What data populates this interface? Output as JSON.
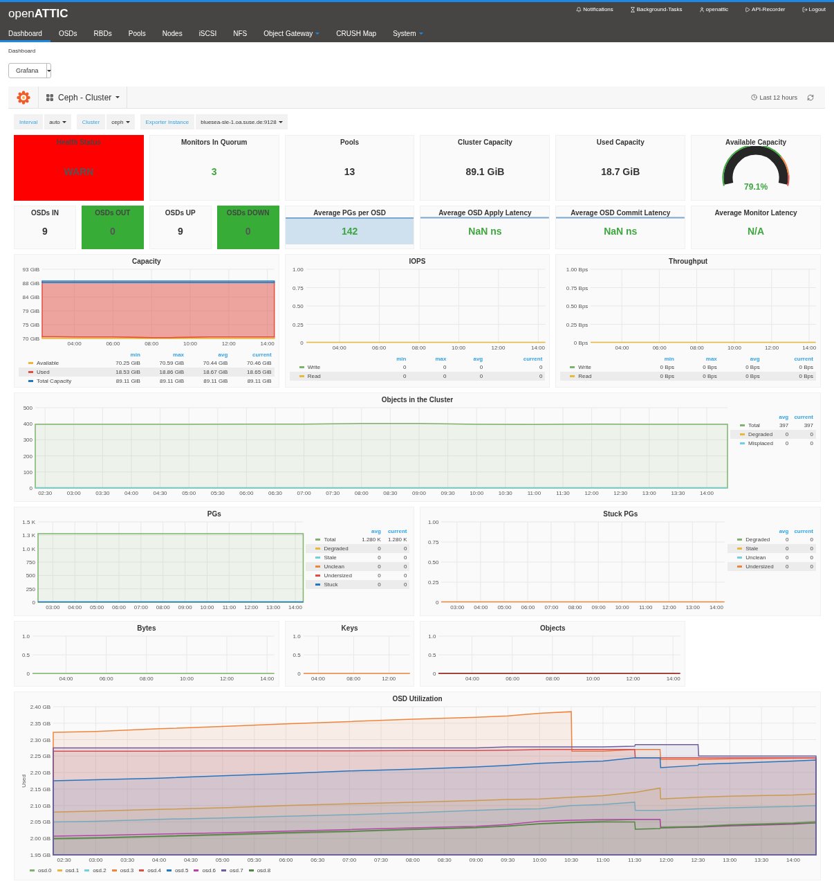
{
  "brand": "open**ATTIC**",
  "top_links": [
    "Notifications",
    "Background-Tasks",
    "openattic",
    "API-Recorder",
    "Logout"
  ],
  "nav": [
    {
      "label": "Dashboard",
      "selected": true,
      "dropdown": false
    },
    {
      "label": "OSDs",
      "selected": false,
      "dropdown": false
    },
    {
      "label": "RBDs",
      "selected": false,
      "dropdown": false
    },
    {
      "label": "Pools",
      "selected": false,
      "dropdown": false
    },
    {
      "label": "Nodes",
      "selected": false,
      "dropdown": false
    },
    {
      "label": "iSCSI",
      "selected": false,
      "dropdown": false
    },
    {
      "label": "NFS",
      "selected": false,
      "dropdown": false
    },
    {
      "label": "Object Gateway",
      "selected": false,
      "dropdown": true
    },
    {
      "label": "CRUSH Map",
      "selected": false,
      "dropdown": false
    },
    {
      "label": "System",
      "selected": false,
      "dropdown": true
    }
  ],
  "breadcrumb": "Dashboard",
  "view_select": {
    "value": "Grafana"
  },
  "dashboard": {
    "title": "Ceph - Cluster",
    "time_range": "Last 12 hours"
  },
  "variables": [
    {
      "label": "Interval",
      "value": "auto"
    },
    {
      "label": "Cluster",
      "value": "ceph"
    },
    {
      "label": "Exporter Instance",
      "value": "bluesea-sle-1.oa.suse.de:9128"
    }
  ],
  "stats": [
    {
      "title": "Health Status",
      "value": "WARN",
      "kind": "stat",
      "color": "#ff0000",
      "highlighted": false
    },
    {
      "title": "Monitors In Quorum",
      "value": "3",
      "kind": "stat",
      "highlighted": true
    },
    {
      "title": "Pools",
      "value": "13",
      "kind": "stat",
      "highlighted": false
    },
    {
      "title": "Cluster Capacity",
      "value": "89.1 GiB",
      "kind": "stat",
      "highlighted": false
    },
    {
      "title": "Used Capacity",
      "value": "18.7 GiB",
      "kind": "stat",
      "highlighted": false
    },
    {
      "title": "Available Capacity",
      "value": "79.1%",
      "kind": "gauge",
      "highlighted": true
    },
    {
      "title": "OSDs IN",
      "value": "9",
      "kind": "stat",
      "highlighted": false
    },
    {
      "title": "OSDs OUT",
      "value": "0",
      "kind": "stat",
      "color": "#37ad37",
      "highlighted": false
    },
    {
      "title": "OSDs UP",
      "value": "9",
      "kind": "stat",
      "highlighted": false
    },
    {
      "title": "OSDs DOWN",
      "value": "0",
      "kind": "stat",
      "color": "#37ad37",
      "highlighted": false
    },
    {
      "title": "Average PGs per OSD",
      "value": "142",
      "kind": "sparkline-fill",
      "highlighted": true
    },
    {
      "title": "Average OSD Apply Latency",
      "value": "NaN ns",
      "kind": "sparkline",
      "highlighted": true
    },
    {
      "title": "Average OSD Commit Latency",
      "value": "NaN ns",
      "kind": "sparkline",
      "highlighted": true
    },
    {
      "title": "Average Monitor Latency",
      "value": "N/A",
      "kind": "stat",
      "highlighted": true
    }
  ],
  "graphs": [
    {
      "title": "Capacity",
      "chart_data": {
        "type": "line",
        "grid": true,
        "x": [
          2.33,
          3,
          4,
          5,
          6,
          7,
          8,
          9,
          10,
          11,
          12,
          13,
          14.36
        ],
        "xlim": [
          2.33,
          14.36
        ],
        "ylim": [
          70,
          93
        ],
        "xticks": [
          {
            "value": 4,
            "label": "04:00"
          },
          {
            "value": 6,
            "label": "06:00"
          },
          {
            "value": 8,
            "label": "08:00"
          },
          {
            "value": 10,
            "label": "10:00"
          },
          {
            "value": 12,
            "label": "12:00"
          },
          {
            "value": 14,
            "label": "14:00"
          }
        ],
        "yticks": [
          {
            "value": 70,
            "label": "70 GiB"
          },
          {
            "value": 74.6,
            "label": "75 GiB"
          },
          {
            "value": 79.2,
            "label": "79 GiB"
          },
          {
            "value": 83.8,
            "label": "84 GiB"
          },
          {
            "value": 88.4,
            "label": "88 GiB"
          },
          {
            "value": 93,
            "label": "93 GiB"
          }
        ],
        "series": [
          {
            "name": "Available",
            "type": "area",
            "color": "#eab839",
            "values": [
              70.6,
              70.6,
              70.5,
              70.5,
              70.5,
              70.4,
              70.3,
              70.3,
              70.4,
              70.5,
              70.5,
              70.5,
              70.5
            ]
          },
          {
            "name": "Used",
            "type": "area",
            "color": "#e24d42",
            "values": [
              88.6,
              88.6,
              88.6,
              88.6,
              88.6,
              88.6,
              88.6,
              88.6,
              88.6,
              88.6,
              88.6,
              88.6,
              88.6
            ]
          },
          {
            "name": "Total Capacity",
            "type": "area",
            "color": "#1f78c1",
            "values": [
              89.1,
              89.1,
              89.1,
              89.1,
              89.1,
              89.1,
              89.1,
              89.1,
              89.1,
              89.1,
              89.1,
              89.1,
              89.1
            ]
          }
        ]
      },
      "legend": {
        "kind": "table-below",
        "columns": [
          "min",
          "max",
          "avg",
          "current"
        ],
        "rows": [
          {
            "cells": [
              "70.25 GiB",
              "70.59 GiB",
              "70.44 GiB",
              "70.46 GiB"
            ]
          },
          {
            "cells": [
              "18.53 GiB",
              "18.86 GiB",
              "18.67 GiB",
              "18.65 GiB"
            ]
          },
          {
            "cells": [
              "89.11 GiB",
              "89.11 GiB",
              "89.11 GiB",
              "89.11 GiB"
            ]
          }
        ]
      }
    },
    {
      "title": "IOPS",
      "chart_data": {
        "type": "line",
        "grid": true,
        "x": [
          2.33,
          14.36
        ],
        "xlim": [
          2.33,
          14.36
        ],
        "ylim": [
          0,
          1
        ],
        "xticks": [
          {
            "value": 4,
            "label": "04:00"
          },
          {
            "value": 6,
            "label": "06:00"
          },
          {
            "value": 8,
            "label": "08:00"
          },
          {
            "value": 10,
            "label": "10:00"
          },
          {
            "value": 12,
            "label": "12:00"
          },
          {
            "value": 14,
            "label": "14:00"
          }
        ],
        "yticks": [
          0,
          {
            "value": 0.25,
            "label": "0.25"
          },
          {
            "value": 0.5,
            "label": "0.50"
          },
          {
            "value": 0.75,
            "label": "0.75"
          },
          {
            "value": 1,
            "label": "1.00"
          }
        ],
        "series": [
          {
            "name": "Write",
            "color": "#7eb26d",
            "values": [
              null,
              null
            ]
          },
          {
            "name": "Read",
            "color": "#eab839",
            "values": [
              0,
              0
            ]
          }
        ]
      },
      "legend": {
        "kind": "table-below",
        "columns": [
          "min",
          "max",
          "avg",
          "current"
        ],
        "rows": [
          {
            "cells": [
              "0",
              "0",
              "0",
              "0"
            ]
          },
          {
            "cells": [
              "0",
              "0",
              "0",
              "0"
            ]
          }
        ]
      }
    },
    {
      "title": "Throughput",
      "chart_data": {
        "type": "line",
        "grid": true,
        "x": [
          2.33,
          14.36
        ],
        "xlim": [
          2.33,
          14.36
        ],
        "ylim": [
          0,
          1
        ],
        "xticks": [
          {
            "value": 4,
            "label": "04:00"
          },
          {
            "value": 6,
            "label": "06:00"
          },
          {
            "value": 8,
            "label": "08:00"
          },
          {
            "value": 10,
            "label": "10:00"
          },
          {
            "value": 12,
            "label": "12:00"
          },
          {
            "value": 14,
            "label": "14:00"
          }
        ],
        "yticks": [
          {
            "value": 0,
            "label": "0 Bps"
          },
          {
            "value": 0.25,
            "label": "0.25 Bps"
          },
          {
            "value": 0.5,
            "label": "0.50 Bps"
          },
          {
            "value": 0.75,
            "label": "0.75 Bps"
          },
          {
            "value": 1,
            "label": "1.00 Bps"
          }
        ],
        "series": [
          {
            "name": "Write",
            "color": "#7eb26d",
            "values": [
              null,
              null
            ]
          },
          {
            "name": "Read",
            "color": "#eab839",
            "values": [
              0,
              0
            ]
          }
        ]
      },
      "legend": {
        "kind": "table-below",
        "columns": [
          "min",
          "max",
          "avg",
          "current"
        ],
        "rows": [
          {
            "cells": [
              "0 Bps",
              "0 Bps",
              "0 Bps",
              "0 Bps"
            ]
          },
          {
            "cells": [
              "0 Bps",
              "0 Bps",
              "0 Bps",
              "0 Bps"
            ]
          }
        ]
      }
    },
    {
      "title": "Objects in the Cluster",
      "chart_data": {
        "type": "line",
        "grid": true,
        "x": [
          2.33,
          3,
          4,
          5,
          6,
          7,
          8,
          9,
          10,
          11,
          12,
          13,
          14.36
        ],
        "xlim": [
          2.33,
          14.36
        ],
        "ylim": [
          0,
          500
        ],
        "xticks": [
          {
            "value": 2.5,
            "label": "02:30"
          },
          {
            "value": 3,
            "label": "03:00"
          },
          {
            "value": 3.5,
            "label": "03:30"
          },
          {
            "value": 4,
            "label": "04:00"
          },
          {
            "value": 4.5,
            "label": "04:30"
          },
          {
            "value": 5,
            "label": "05:00"
          },
          {
            "value": 5.5,
            "label": "05:30"
          },
          {
            "value": 6,
            "label": "06:00"
          },
          {
            "value": 6.5,
            "label": "06:30"
          },
          {
            "value": 7,
            "label": "07:00"
          },
          {
            "value": 7.5,
            "label": "07:30"
          },
          {
            "value": 8,
            "label": "08:00"
          },
          {
            "value": 8.5,
            "label": "08:30"
          },
          {
            "value": 9,
            "label": "09:00"
          },
          {
            "value": 9.5,
            "label": "09:30"
          },
          {
            "value": 10,
            "label": "10:00"
          },
          {
            "value": 10.5,
            "label": "10:30"
          },
          {
            "value": 11,
            "label": "11:00"
          },
          {
            "value": 11.5,
            "label": "11:30"
          },
          {
            "value": 12,
            "label": "12:00"
          },
          {
            "value": 12.5,
            "label": "12:30"
          },
          {
            "value": 13,
            "label": "13:00"
          },
          {
            "value": 13.5,
            "label": "13:30"
          },
          {
            "value": 14,
            "label": "14:00"
          }
        ],
        "yticks": [
          0,
          100,
          200,
          300,
          400,
          500
        ],
        "series": [
          {
            "name": "Total",
            "type": "area",
            "color": "#7eb26d",
            "values": [
              397,
              397,
              397,
              397,
              398,
              398,
              402,
              402,
              397,
              395,
              398,
              397,
              397
            ]
          },
          {
            "name": "Degraded",
            "color": "#eab839",
            "values": [
              null,
              null,
              null,
              null,
              null,
              null,
              null,
              null,
              null,
              null,
              null,
              null,
              null
            ]
          },
          {
            "name": "Misplaced",
            "color": "#6ed0e0",
            "values": [
              0,
              0,
              0,
              0,
              0,
              0,
              0,
              0,
              0,
              0,
              0,
              0,
              0
            ]
          }
        ]
      },
      "legend": {
        "kind": "table-right",
        "columns": [
          "avg",
          "current"
        ],
        "rows": [
          {
            "cells": [
              "397",
              "397"
            ]
          },
          {
            "cells": [
              "0",
              "0"
            ]
          },
          {
            "cells": [
              "0",
              "0"
            ]
          }
        ]
      }
    },
    {
      "title": "PGs",
      "chart_data": {
        "type": "line",
        "grid": true,
        "x": [
          2.33,
          14.36
        ],
        "xlim": [
          2.33,
          14.36
        ],
        "ylim": [
          0,
          1500
        ],
        "xticks": [
          {
            "value": 3,
            "label": "03:00"
          },
          {
            "value": 4,
            "label": "04:00"
          },
          {
            "value": 5,
            "label": "05:00"
          },
          {
            "value": 6,
            "label": "06:00"
          },
          {
            "value": 7,
            "label": "07:00"
          },
          {
            "value": 8,
            "label": "08:00"
          },
          {
            "value": 9,
            "label": "09:00"
          },
          {
            "value": 10,
            "label": "10:00"
          },
          {
            "value": 11,
            "label": "11:00"
          },
          {
            "value": 12,
            "label": "12:00"
          },
          {
            "value": 13,
            "label": "13:00"
          },
          {
            "value": 14,
            "label": "14:00"
          }
        ],
        "yticks": [
          0,
          250,
          500,
          750,
          {
            "value": 1000,
            "label": "1.0 K"
          },
          {
            "value": 1250,
            "label": "1.3 K"
          },
          {
            "value": 1500,
            "label": "1.5 K"
          }
        ],
        "series": [
          {
            "name": "Total",
            "type": "area",
            "color": "#7eb26d",
            "values": [
              1280,
              1280
            ]
          },
          {
            "name": "Degraded",
            "color": "#eab839",
            "values": [
              null,
              null
            ]
          },
          {
            "name": "Stale",
            "color": "#6ed0e0",
            "values": [
              null,
              null
            ]
          },
          {
            "name": "Unclean",
            "color": "#ef843c",
            "values": [
              null,
              null
            ]
          },
          {
            "name": "Undersized",
            "color": "#e24d42",
            "values": [
              null,
              null
            ]
          },
          {
            "name": "Stuck",
            "color": "#1f78c1",
            "values": [
              0,
              0
            ]
          }
        ]
      },
      "legend": {
        "kind": "table-right",
        "columns": [
          "avg",
          "current"
        ],
        "rows": [
          {
            "cells": [
              "1.280 K",
              "1.280 K"
            ]
          },
          {
            "cells": [
              "0",
              "0"
            ]
          },
          {
            "cells": [
              "0",
              "0"
            ]
          },
          {
            "cells": [
              "0",
              "0"
            ]
          },
          {
            "cells": [
              "0",
              "0"
            ]
          },
          {
            "cells": [
              "0",
              "0"
            ]
          }
        ]
      }
    },
    {
      "title": "Stuck PGs",
      "chart_data": {
        "type": "line",
        "grid": true,
        "x": [
          2.33,
          14.36
        ],
        "xlim": [
          2.33,
          14.36
        ],
        "ylim": [
          0,
          1
        ],
        "xticks": [
          {
            "value": 3,
            "label": "03:00"
          },
          {
            "value": 4,
            "label": "04:00"
          },
          {
            "value": 5,
            "label": "05:00"
          },
          {
            "value": 6,
            "label": "06:00"
          },
          {
            "value": 7,
            "label": "07:00"
          },
          {
            "value": 8,
            "label": "08:00"
          },
          {
            "value": 9,
            "label": "09:00"
          },
          {
            "value": 10,
            "label": "10:00"
          },
          {
            "value": 11,
            "label": "11:00"
          },
          {
            "value": 12,
            "label": "12:00"
          },
          {
            "value": 13,
            "label": "13:00"
          },
          {
            "value": 14,
            "label": "14:00"
          }
        ],
        "yticks": [
          0,
          {
            "value": 0.25,
            "label": "0.25"
          },
          {
            "value": 0.5,
            "label": "0.50"
          },
          {
            "value": 0.75,
            "label": "0.75"
          },
          {
            "value": 1,
            "label": "1.00"
          }
        ],
        "series": [
          {
            "name": "Degraded",
            "color": "#7eb26d",
            "values": [
              null,
              null
            ]
          },
          {
            "name": "Stale",
            "color": "#eab839",
            "values": [
              null,
              null
            ]
          },
          {
            "name": "Unclean",
            "color": "#6ed0e0",
            "values": [
              null,
              null
            ]
          },
          {
            "name": "Undersized",
            "color": "#ef843c",
            "values": [
              0,
              0
            ]
          }
        ]
      },
      "legend": {
        "kind": "table-right",
        "columns": [
          "avg",
          "current"
        ],
        "rows": [
          {
            "cells": [
              "0",
              "0"
            ]
          },
          {
            "cells": [
              "0",
              "0"
            ]
          },
          {
            "cells": [
              "0",
              "0"
            ]
          },
          {
            "cells": [
              "0",
              "0"
            ]
          }
        ]
      }
    },
    {
      "title": "Bytes",
      "chart_data": {
        "type": "line",
        "grid": true,
        "x": [
          2.33,
          14.36
        ],
        "xlim": [
          2.33,
          14.36
        ],
        "ylim": [
          0,
          1
        ],
        "xticks": [
          {
            "value": 4,
            "label": "04:00"
          },
          {
            "value": 6,
            "label": "06:00"
          },
          {
            "value": 8,
            "label": "08:00"
          },
          {
            "value": 10,
            "label": "10:00"
          },
          {
            "value": 12,
            "label": "12:00"
          },
          {
            "value": 14,
            "label": "14:00"
          }
        ],
        "yticks": [
          0,
          {
            "value": 0.5,
            "label": "0.5"
          },
          {
            "value": 1,
            "label": "1.0"
          }
        ],
        "series": [
          {
            "color": "#7eb26d",
            "values": [
              0,
              0
            ]
          }
        ]
      }
    },
    {
      "title": "Keys",
      "chart_data": {
        "type": "line",
        "grid": true,
        "x": [
          2.33,
          14.36
        ],
        "xlim": [
          2.33,
          14.36
        ],
        "ylim": [
          0,
          1
        ],
        "xticks": [
          {
            "value": 4,
            "label": "04:00"
          },
          {
            "value": 8,
            "label": "08:00"
          },
          {
            "value": 12,
            "label": "12:00"
          }
        ],
        "yticks": [
          0,
          {
            "value": 0.5,
            "label": "0.5"
          },
          {
            "value": 1,
            "label": "1.0"
          }
        ],
        "series": [
          {
            "color": "#ef843c",
            "values": [
              0,
              0
            ]
          }
        ]
      }
    },
    {
      "title": "Objects",
      "chart_data": {
        "type": "line",
        "grid": true,
        "x": [
          2.33,
          14.36
        ],
        "xlim": [
          2.33,
          14.36
        ],
        "ylim": [
          0,
          1
        ],
        "xticks": [
          {
            "value": 4,
            "label": "04:00"
          },
          {
            "value": 6,
            "label": "06:00"
          },
          {
            "value": 8,
            "label": "08:00"
          },
          {
            "value": 10,
            "label": "10:00"
          },
          {
            "value": 12,
            "label": "12:00"
          },
          {
            "value": 14,
            "label": "14:00"
          }
        ],
        "yticks": [
          0,
          {
            "value": 0.5,
            "label": "0.5"
          },
          {
            "value": 1,
            "label": "1.0"
          }
        ],
        "series": [
          {
            "color": "#890f02",
            "values": [
              0,
              0
            ]
          }
        ]
      }
    },
    {
      "title": "OSD Utilization",
      "chart_data": {
        "type": "line",
        "grid": true,
        "ylabel": "Used",
        "x": [
          2.33,
          3,
          4,
          5,
          6,
          7,
          8,
          9,
          9.5,
          10,
          10.5,
          10.51,
          11,
          11.5,
          11.51,
          11.9,
          11.91,
          12.5,
          12.51,
          13,
          14,
          14.36
        ],
        "xlim": [
          2.33,
          14.36
        ],
        "ylim": [
          1.95,
          2.4
        ],
        "xticks": [
          {
            "value": 2.5,
            "label": "02:30"
          },
          {
            "value": 3,
            "label": "03:00"
          },
          {
            "value": 3.5,
            "label": "03:30"
          },
          {
            "value": 4,
            "label": "04:00"
          },
          {
            "value": 4.5,
            "label": "04:30"
          },
          {
            "value": 5,
            "label": "05:00"
          },
          {
            "value": 5.5,
            "label": "05:30"
          },
          {
            "value": 6,
            "label": "06:00"
          },
          {
            "value": 6.5,
            "label": "06:30"
          },
          {
            "value": 7,
            "label": "07:00"
          },
          {
            "value": 7.5,
            "label": "07:30"
          },
          {
            "value": 8,
            "label": "08:00"
          },
          {
            "value": 8.5,
            "label": "08:30"
          },
          {
            "value": 9,
            "label": "09:00"
          },
          {
            "value": 9.5,
            "label": "09:30"
          },
          {
            "value": 10,
            "label": "10:00"
          },
          {
            "value": 10.5,
            "label": "10:30"
          },
          {
            "value": 11,
            "label": "11:00"
          },
          {
            "value": 11.5,
            "label": "11:30"
          },
          {
            "value": 12,
            "label": "12:00"
          },
          {
            "value": 12.5,
            "label": "12:30"
          },
          {
            "value": 13,
            "label": "13:00"
          },
          {
            "value": 13.5,
            "label": "13:30"
          },
          {
            "value": 14,
            "label": "14:00"
          }
        ],
        "yticks": [
          {
            "value": 1.95,
            "label": "1.95 GB"
          },
          {
            "value": 2,
            "label": "2.00 GB"
          },
          {
            "value": 2.05,
            "label": "2.05 GB"
          },
          {
            "value": 2.1,
            "label": "2.10 GB"
          },
          {
            "value": 2.15,
            "label": "2.15 GB"
          },
          {
            "value": 2.2,
            "label": "2.20 GB"
          },
          {
            "value": 2.25,
            "label": "2.25 GB"
          },
          {
            "value": 2.3,
            "label": "2.30 GB"
          },
          {
            "value": 2.35,
            "label": "2.35 GB"
          },
          {
            "value": 2.4,
            "label": "2.40 GB"
          }
        ],
        "series": [
          {
            "name": "osd.0",
            "type": "area",
            "color": "#7eb26d",
            "values": [
              1.998,
              2.0,
              2.005,
              2.01,
              2.015,
              2.02,
              2.027,
              2.032,
              2.037,
              2.045,
              2.05,
              2.05,
              2.053,
              2.058,
              2.058,
              2.058,
              2.035,
              2.037,
              2.037,
              2.042,
              2.047,
              2.052
            ]
          },
          {
            "name": "osd.1",
            "type": "area",
            "color": "#eab839",
            "values": [
              2.08,
              2.083,
              2.088,
              2.093,
              2.1,
              2.105,
              2.11,
              2.115,
              2.118,
              2.12,
              2.125,
              2.125,
              2.13,
              2.14,
              2.14,
              2.153,
              2.12,
              2.125,
              2.125,
              2.128,
              2.132,
              2.135
            ]
          },
          {
            "name": "osd.2",
            "type": "area",
            "color": "#6ed0e0",
            "values": [
              2.05,
              2.052,
              2.058,
              2.062,
              2.067,
              2.072,
              2.078,
              2.085,
              2.088,
              2.09,
              2.1,
              2.1,
              2.103,
              2.11,
              2.085,
              2.085,
              2.085,
              2.09,
              2.09,
              2.093,
              2.097,
              2.1
            ]
          },
          {
            "name": "osd.3",
            "type": "area",
            "color": "#ef843c",
            "values": [
              2.322,
              2.325,
              2.333,
              2.34,
              2.348,
              2.355,
              2.362,
              2.368,
              2.372,
              2.38,
              2.385,
              2.265,
              2.265,
              2.27,
              2.27,
              2.27,
              2.24,
              2.24,
              2.24,
              2.242,
              2.244,
              2.245
            ]
          },
          {
            "name": "osd.4",
            "type": "area",
            "color": "#e24d42",
            "values": [
              2.265,
              2.265,
              2.265,
              2.266,
              2.266,
              2.266,
              2.267,
              2.267,
              2.268,
              2.27,
              2.27,
              2.27,
              2.27,
              2.27,
              2.245,
              2.245,
              2.245,
              2.245,
              2.245,
              2.245,
              2.245,
              2.245
            ]
          },
          {
            "name": "osd.5",
            "type": "area",
            "color": "#1f78c1",
            "values": [
              2.175,
              2.178,
              2.183,
              2.19,
              2.197,
              2.205,
              2.21,
              2.217,
              2.222,
              2.228,
              2.232,
              2.232,
              2.235,
              2.245,
              2.245,
              2.245,
              2.215,
              2.222,
              2.225,
              2.228,
              2.235,
              2.238
            ]
          },
          {
            "name": "osd.6",
            "type": "line",
            "color": "#ba43a9",
            "values": [
              2.007,
              2.009,
              2.013,
              2.017,
              2.022,
              2.027,
              2.032,
              2.037,
              2.042,
              2.052,
              2.055,
              2.055,
              2.057,
              2.058,
              2.058,
              2.058,
              2.032,
              2.034,
              2.034,
              2.038,
              2.043,
              2.047
            ]
          },
          {
            "name": "osd.7",
            "type": "area",
            "color": "#705da0",
            "values": [
              2.275,
              2.275,
              2.275,
              2.275,
              2.275,
              2.275,
              2.275,
              2.275,
              2.278,
              2.278,
              2.278,
              2.278,
              2.278,
              2.28,
              2.285,
              2.285,
              2.285,
              2.285,
              2.25,
              2.25,
              2.25,
              2.25
            ]
          },
          {
            "name": "osd.8",
            "type": "line",
            "color": "#508642",
            "values": [
              2.0,
              2.002,
              2.007,
              2.012,
              2.018,
              2.022,
              2.028,
              2.033,
              2.038,
              2.044,
              2.048,
              2.048,
              2.05,
              2.05,
              2.028,
              2.03,
              2.032,
              2.035,
              2.035,
              2.04,
              2.045,
              2.048
            ]
          }
        ]
      },
      "legend": {
        "kind": "inline"
      }
    }
  ]
}
